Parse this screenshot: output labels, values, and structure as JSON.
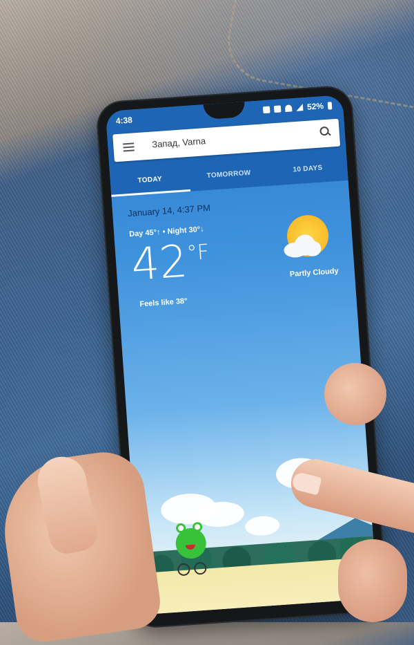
{
  "status_bar": {
    "time": "4:38",
    "battery": "52%"
  },
  "search": {
    "location": "Запад, Varna"
  },
  "tabs": [
    {
      "label": "TODAY",
      "active": true
    },
    {
      "label": "TOMORROW",
      "active": false
    },
    {
      "label": "10 DAYS",
      "active": false
    }
  ],
  "weather": {
    "date": "January 14, 4:37 PM",
    "day_night": "Day 45°↑ • Night 30°↓",
    "temperature": "42",
    "unit": "°F",
    "feels_like": "Feels like 38°",
    "condition": "Partly Cloudy",
    "condition_icon": "partly-cloudy-icon"
  },
  "colors": {
    "app_bar": "#1e66b5",
    "sky_top": "#2f80d0",
    "sun": "#f5b21d",
    "frog": "#38c23a"
  }
}
